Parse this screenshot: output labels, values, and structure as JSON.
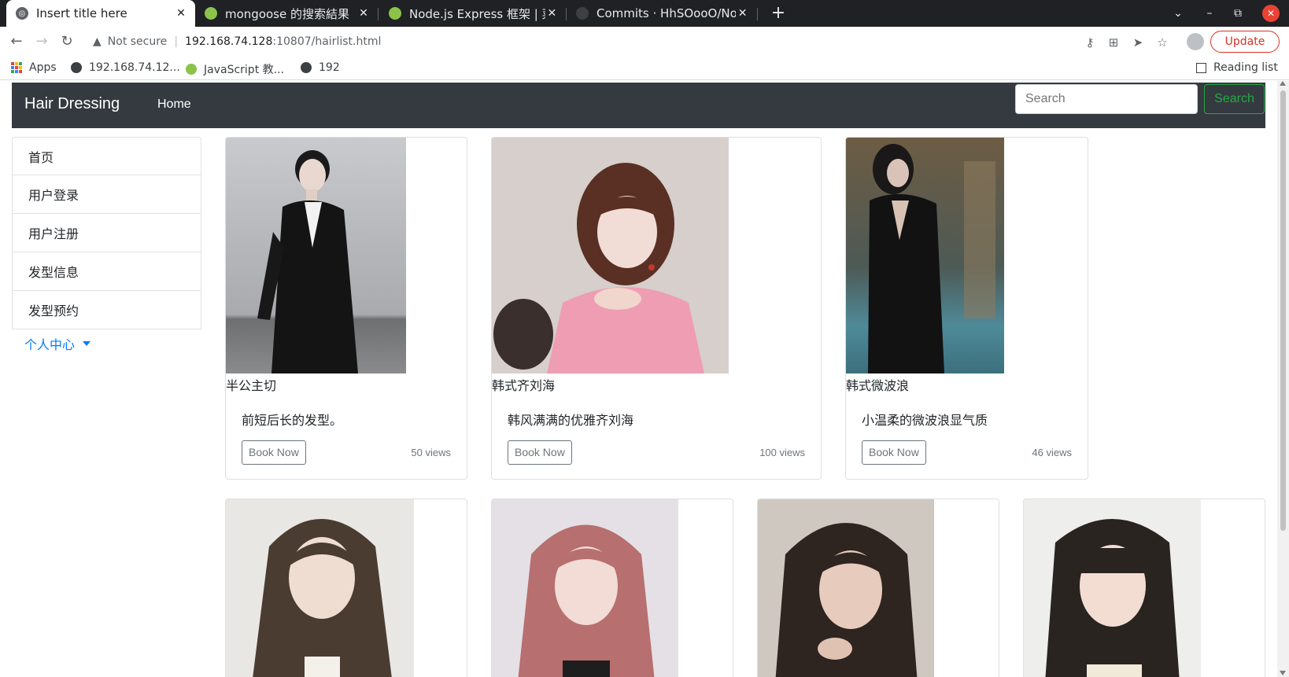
{
  "browser": {
    "tabs": [
      {
        "title": "Insert title here",
        "active": true
      },
      {
        "title": "mongoose 的搜索結果",
        "active": false
      },
      {
        "title": "Node.js Express 框架 | 菜鸟",
        "active": false
      },
      {
        "title": "Commits · HhSOooO/NodeJs",
        "active": false
      }
    ],
    "address": {
      "security_label": "Not secure",
      "host": "192.168.74.128",
      "path": ":10807/hairlist.html"
    },
    "update_label": "Update",
    "bookmarks": [
      {
        "label": "Apps"
      },
      {
        "label": "192.168.74.12..."
      },
      {
        "label": "JavaScript 教..."
      },
      {
        "label": "192"
      }
    ],
    "reading_list_label": "Reading list"
  },
  "navbar": {
    "brand": "Hair Dressing",
    "home": "Home",
    "search_placeholder": "Search",
    "search_button": "Search"
  },
  "sidebar": {
    "items": [
      {
        "label": "首页"
      },
      {
        "label": "用户登录"
      },
      {
        "label": "用户注册"
      },
      {
        "label": "发型信息"
      },
      {
        "label": "发型预约"
      }
    ],
    "dropdown_label": "个人中心"
  },
  "cards": [
    {
      "title": "半公主切",
      "description": "前短后长的发型。",
      "button": "Book Now",
      "views": "50 views"
    },
    {
      "title": "韩式齐刘海",
      "description": "韩风满满的优雅齐刘海",
      "button": "Book Now",
      "views": "100 views"
    },
    {
      "title": "韩式微波浪",
      "description": "小温柔的微波浪显气质",
      "button": "Book Now",
      "views": "46 views"
    }
  ],
  "colors": {
    "navbar_bg": "#343a40",
    "search_button": "#28a745",
    "dropdown_link": "#007bff",
    "update_button": "#d93025"
  }
}
